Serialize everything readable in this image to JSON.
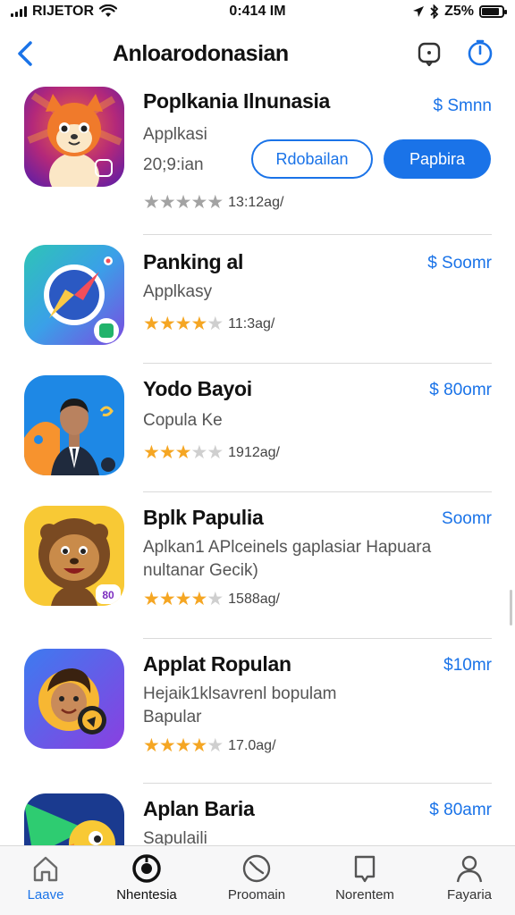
{
  "status": {
    "carrier": "RIJETOR",
    "time": "0:414 IM",
    "battery": "Z5%",
    "battery_level": 0.85
  },
  "nav": {
    "title": "Anloarodonasian"
  },
  "apps": [
    {
      "name": "Poplkania Ilnunasia",
      "subtitle": "Applkasi",
      "subtitle2": "20;9:ian",
      "price": "$ Smnn",
      "rating_text": "13:12ag/",
      "stars_value": 5,
      "stars_grey": true,
      "open_label": "Rdobailan",
      "get_label": "Papbira"
    },
    {
      "name": "Panking al",
      "subtitle": "Applkasy",
      "price": "$ Soomr",
      "rating_text": "11:3ag/",
      "stars_value": 4
    },
    {
      "name": "Yodo Bayoi",
      "subtitle": "Copula Ke",
      "price": "$ 80omr",
      "rating_text": "1912ag/",
      "stars_value": 3
    },
    {
      "name": "Bplk Papulia",
      "subtitle": "Aplkan1 APlceinels gaplasiar Hapuara",
      "subtitle2": "nultanar Gecik)",
      "price": "Soomr",
      "rating_text": "1588ag/",
      "stars_value": 4
    },
    {
      "name": "Applat Ropulan",
      "subtitle": "Hejaik1klsavrenl bopulam",
      "subtitle2": "Bapular",
      "price": "$10mr",
      "rating_text": "17.0ag/",
      "stars_value": 4
    },
    {
      "name": "Aplan Baria",
      "subtitle": "Sapulaili",
      "price": "$ 80amr"
    }
  ],
  "tabs": [
    {
      "label": "Laave",
      "icon": "home-icon"
    },
    {
      "label": "Nhentesia",
      "icon": "target-icon"
    },
    {
      "label": "Proomain",
      "icon": "compass-icon"
    },
    {
      "label": "Norentem",
      "icon": "document-icon"
    },
    {
      "label": "Fayaria",
      "icon": "person-icon"
    }
  ],
  "colors": {
    "accent": "#1a73e8",
    "star": "#f5a623"
  }
}
